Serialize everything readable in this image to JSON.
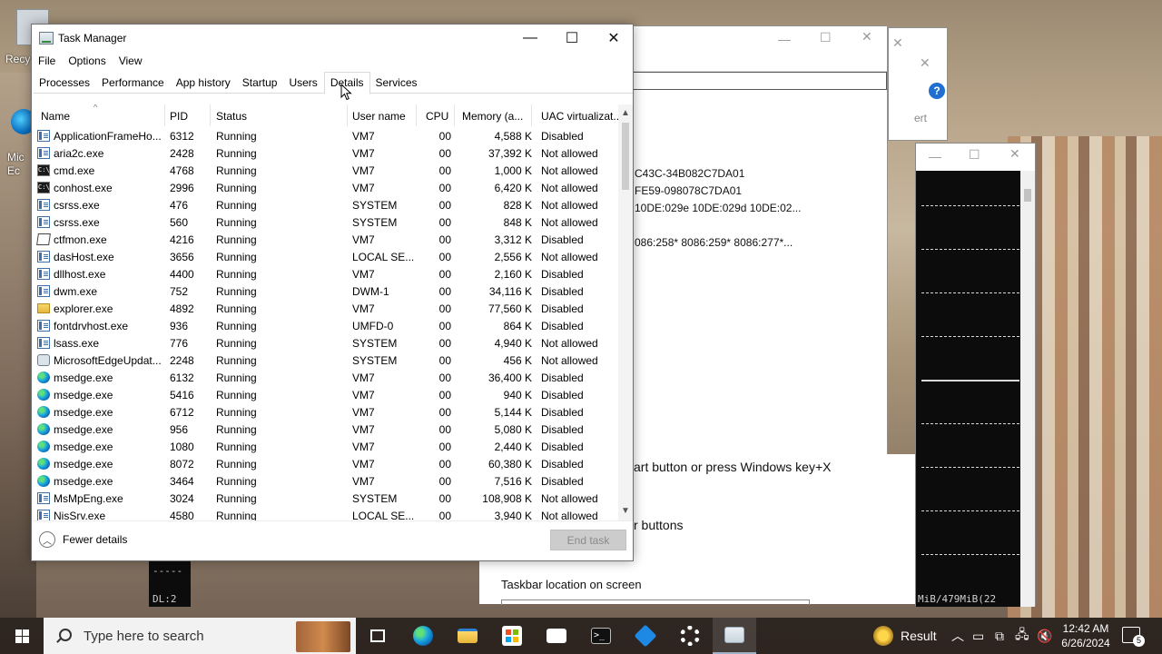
{
  "desktop": {
    "recycle_label": "Recy",
    "edge_label_1": "Mic",
    "edge_label_2": "Ec"
  },
  "background": {
    "sysinfo_lines": [
      "C43C-34B082C7DA01",
      "FE59-098078C7DA01",
      "10DE:029e 10DE:029d 10DE:02...",
      "086:258* 8086:259* 8086:277*..."
    ],
    "ert_fragment": "ert",
    "settings_fragments": [
      "art button or press Windows key+X",
      "r buttons"
    ],
    "taskbar_location_label": "Taskbar location on screen",
    "terminal_status": "DL:2",
    "terminal_status_right": "MiB/479MiB(22"
  },
  "taskmanager": {
    "title": "Task Manager",
    "menu": [
      "File",
      "Options",
      "View"
    ],
    "tabs": [
      "Processes",
      "Performance",
      "App history",
      "Startup",
      "Users",
      "Details",
      "Services"
    ],
    "active_tab": "Details",
    "columns": [
      "Name",
      "PID",
      "Status",
      "User name",
      "CPU",
      "Memory (a...",
      "UAC virtualizat..."
    ],
    "rows": [
      {
        "icon": "app-icon",
        "name": "ApplicationFrameHo...",
        "pid": "6312",
        "status": "Running",
        "user": "VM7",
        "cpu": "00",
        "mem": "4,588 K",
        "uac": "Disabled"
      },
      {
        "icon": "app-icon",
        "name": "aria2c.exe",
        "pid": "2428",
        "status": "Running",
        "user": "VM7",
        "cpu": "00",
        "mem": "37,392 K",
        "uac": "Not allowed"
      },
      {
        "icon": "cmd-icon",
        "name": "cmd.exe",
        "pid": "4768",
        "status": "Running",
        "user": "VM7",
        "cpu": "00",
        "mem": "1,000 K",
        "uac": "Not allowed"
      },
      {
        "icon": "cmd-icon",
        "name": "conhost.exe",
        "pid": "2996",
        "status": "Running",
        "user": "VM7",
        "cpu": "00",
        "mem": "6,420 K",
        "uac": "Not allowed"
      },
      {
        "icon": "app-icon",
        "name": "csrss.exe",
        "pid": "476",
        "status": "Running",
        "user": "SYSTEM",
        "cpu": "00",
        "mem": "828 K",
        "uac": "Not allowed"
      },
      {
        "icon": "app-icon",
        "name": "csrss.exe",
        "pid": "560",
        "status": "Running",
        "user": "SYSTEM",
        "cpu": "00",
        "mem": "848 K",
        "uac": "Not allowed"
      },
      {
        "icon": "pen-icon",
        "name": "ctfmon.exe",
        "pid": "4216",
        "status": "Running",
        "user": "VM7",
        "cpu": "00",
        "mem": "3,312 K",
        "uac": "Disabled"
      },
      {
        "icon": "app-icon",
        "name": "dasHost.exe",
        "pid": "3656",
        "status": "Running",
        "user": "LOCAL SE...",
        "cpu": "00",
        "mem": "2,556 K",
        "uac": "Not allowed"
      },
      {
        "icon": "app-icon",
        "name": "dllhost.exe",
        "pid": "4400",
        "status": "Running",
        "user": "VM7",
        "cpu": "00",
        "mem": "2,160 K",
        "uac": "Disabled"
      },
      {
        "icon": "app-icon",
        "name": "dwm.exe",
        "pid": "752",
        "status": "Running",
        "user": "DWM-1",
        "cpu": "00",
        "mem": "34,116 K",
        "uac": "Disabled"
      },
      {
        "icon": "folder-icon",
        "name": "explorer.exe",
        "pid": "4892",
        "status": "Running",
        "user": "VM7",
        "cpu": "00",
        "mem": "77,560 K",
        "uac": "Disabled"
      },
      {
        "icon": "app-icon",
        "name": "fontdrvhost.exe",
        "pid": "936",
        "status": "Running",
        "user": "UMFD-0",
        "cpu": "00",
        "mem": "864 K",
        "uac": "Disabled"
      },
      {
        "icon": "app-icon",
        "name": "lsass.exe",
        "pid": "776",
        "status": "Running",
        "user": "SYSTEM",
        "cpu": "00",
        "mem": "4,940 K",
        "uac": "Not allowed"
      },
      {
        "icon": "update-icon",
        "name": "MicrosoftEdgeUpdat...",
        "pid": "2248",
        "status": "Running",
        "user": "SYSTEM",
        "cpu": "00",
        "mem": "456 K",
        "uac": "Not allowed"
      },
      {
        "icon": "edge-icon",
        "name": "msedge.exe",
        "pid": "6132",
        "status": "Running",
        "user": "VM7",
        "cpu": "00",
        "mem": "36,400 K",
        "uac": "Disabled"
      },
      {
        "icon": "edge-icon",
        "name": "msedge.exe",
        "pid": "5416",
        "status": "Running",
        "user": "VM7",
        "cpu": "00",
        "mem": "940 K",
        "uac": "Disabled"
      },
      {
        "icon": "edge-icon",
        "name": "msedge.exe",
        "pid": "6712",
        "status": "Running",
        "user": "VM7",
        "cpu": "00",
        "mem": "5,144 K",
        "uac": "Disabled"
      },
      {
        "icon": "edge-icon",
        "name": "msedge.exe",
        "pid": "956",
        "status": "Running",
        "user": "VM7",
        "cpu": "00",
        "mem": "5,080 K",
        "uac": "Disabled"
      },
      {
        "icon": "edge-icon",
        "name": "msedge.exe",
        "pid": "1080",
        "status": "Running",
        "user": "VM7",
        "cpu": "00",
        "mem": "2,440 K",
        "uac": "Disabled"
      },
      {
        "icon": "edge-icon",
        "name": "msedge.exe",
        "pid": "8072",
        "status": "Running",
        "user": "VM7",
        "cpu": "00",
        "mem": "60,380 K",
        "uac": "Disabled"
      },
      {
        "icon": "edge-icon",
        "name": "msedge.exe",
        "pid": "3464",
        "status": "Running",
        "user": "VM7",
        "cpu": "00",
        "mem": "7,516 K",
        "uac": "Disabled"
      },
      {
        "icon": "app-icon",
        "name": "MsMpEng.exe",
        "pid": "3024",
        "status": "Running",
        "user": "SYSTEM",
        "cpu": "00",
        "mem": "108,908 K",
        "uac": "Not allowed"
      },
      {
        "icon": "app-icon",
        "name": "NisSrv.exe",
        "pid": "4580",
        "status": "Running",
        "user": "LOCAL SE...",
        "cpu": "00",
        "mem": "3,940 K",
        "uac": "Not allowed"
      }
    ],
    "fewer_details_label": "Fewer details",
    "end_task_label": "End task"
  },
  "taskbar": {
    "search_placeholder": "Type here to search",
    "weather_label": "Result",
    "time": "12:42 AM",
    "date": "6/26/2024",
    "notification_count": "5",
    "apps": [
      "task-view-icon",
      "edge-icon",
      "file-explorer-icon",
      "store-icon",
      "mail-icon",
      "terminal-icon",
      "app-icon",
      "settings-icon",
      "task-manager-icon"
    ]
  }
}
